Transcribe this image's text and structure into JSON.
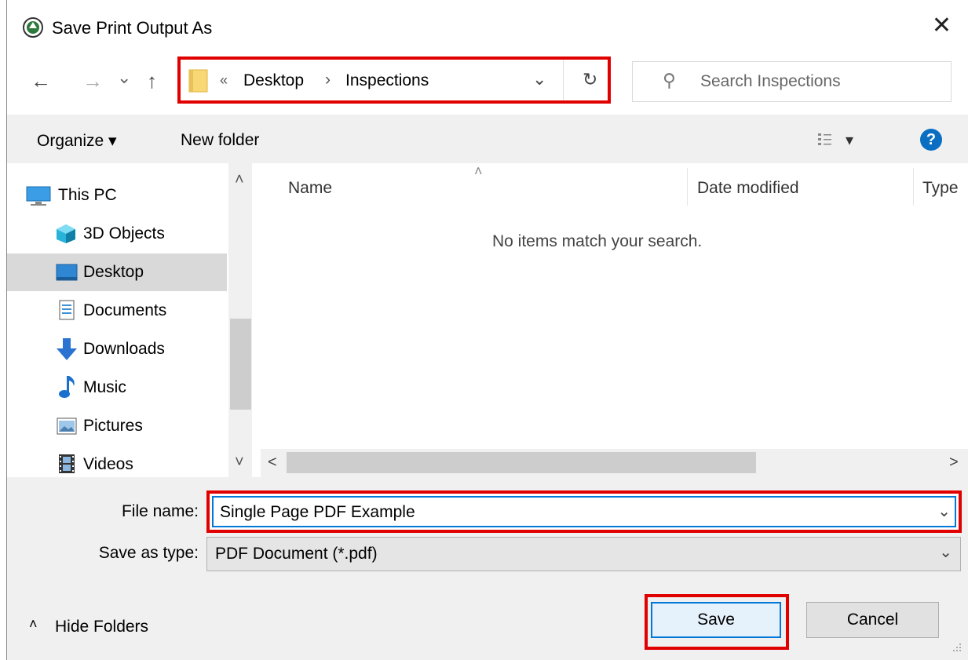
{
  "window": {
    "title": "Save Print Output As",
    "close_glyph": "✕"
  },
  "nav": {
    "back_glyph": "←",
    "forward_glyph": "→",
    "recent_glyph": "⌄",
    "up_glyph": "↑",
    "breadcrumb": {
      "overflow": "«",
      "items": [
        "Desktop",
        "Inspections"
      ],
      "separator": "›"
    },
    "dropdown_glyph": "⌄",
    "refresh_glyph": "↻"
  },
  "search": {
    "placeholder": "Search Inspections",
    "icon_glyph": "⚲"
  },
  "toolbar": {
    "organize_label": "Organize ▾",
    "new_folder_label": "New folder",
    "view_caret": "▾",
    "help_glyph": "?"
  },
  "sidebar": {
    "items": [
      {
        "label": "This PC",
        "icon": "computer-icon"
      },
      {
        "label": "3D Objects",
        "icon": "cube-icon"
      },
      {
        "label": "Desktop",
        "icon": "desktop-icon",
        "selected": true
      },
      {
        "label": "Documents",
        "icon": "document-icon"
      },
      {
        "label": "Downloads",
        "icon": "download-arrow-icon"
      },
      {
        "label": "Music",
        "icon": "music-note-icon"
      },
      {
        "label": "Pictures",
        "icon": "picture-icon"
      },
      {
        "label": "Videos",
        "icon": "film-icon"
      }
    ],
    "scroll_up_glyph": "˄",
    "scroll_down_glyph": "˅"
  },
  "file_list": {
    "columns": [
      "Name",
      "Date modified",
      "Type"
    ],
    "sort_indicator": "˄",
    "empty_message": "No items match your search.",
    "scroll_left_glyph": "<",
    "scroll_right_glyph": ">"
  },
  "form": {
    "filename_label": "File name:",
    "filename_value": "Single Page PDF Example",
    "type_label": "Save as type:",
    "type_value": "PDF Document (*.pdf)",
    "dropdown_glyph": "⌄"
  },
  "footer": {
    "hide_folders_glyph": "˄",
    "hide_folders_label": "Hide Folders",
    "save_label": "Save",
    "cancel_label": "Cancel"
  },
  "colors": {
    "highlight": "#e00000",
    "accent": "#0078d7",
    "help": "#0a6fc2"
  }
}
